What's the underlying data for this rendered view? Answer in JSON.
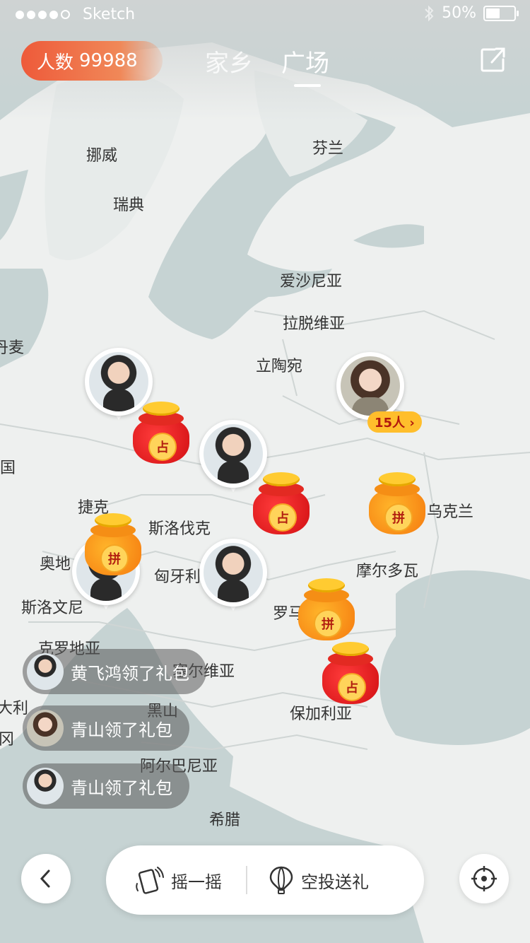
{
  "status_bar": {
    "carrier": "Sketch",
    "battery": "50%"
  },
  "header": {
    "count_label": "人数",
    "count_value": "99988",
    "tabs": [
      {
        "label": "家乡",
        "active": false
      },
      {
        "label": "广场",
        "active": true
      }
    ]
  },
  "map": {
    "countries": [
      "挪威",
      "芬兰",
      "瑞典",
      "爱沙尼亚",
      "拉脱维亚",
      "丹麦",
      "立陶宛",
      "国",
      "捷克",
      "斯洛伐克",
      "奥地",
      "乌克兰",
      "匈牙利",
      "摩尔多瓦",
      "斯洛文尼",
      "罗马",
      "克罗地亚",
      "塞尔维亚",
      "黑山",
      "保加利亚",
      "阿尔巴尼亚",
      "希腊",
      "大利",
      "冈"
    ]
  },
  "pins": {
    "group_badge": "15人",
    "bag_red_char": "占",
    "bag_orange_char": "拼"
  },
  "notifications": [
    {
      "text": "黄飞鸿领了礼包"
    },
    {
      "text": "青山领了礼包"
    },
    {
      "text": "青山领了礼包"
    }
  ],
  "bottom_bar": {
    "shake_label": "摇一摇",
    "airdrop_label": "空投送礼"
  },
  "colors": {
    "accent_orange": "#ee5a3a",
    "badge_yellow": "#ffbe2c",
    "bag_red": "#d10f12",
    "bag_orange": "#f57a0f"
  }
}
